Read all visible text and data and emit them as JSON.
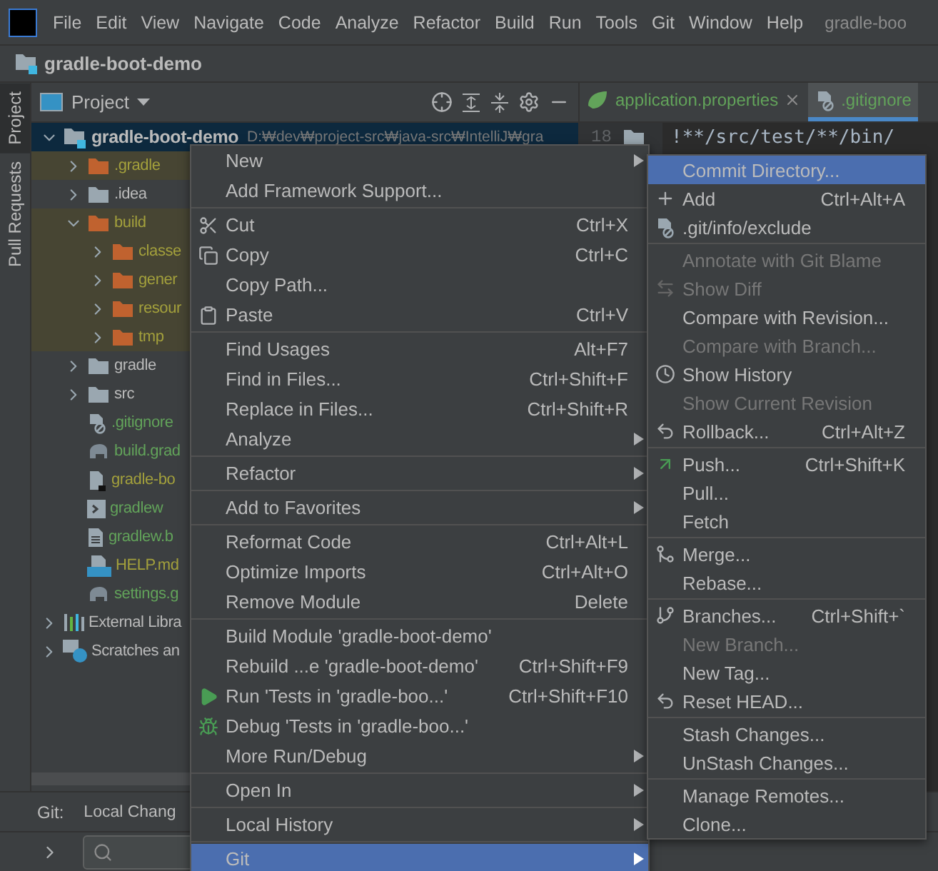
{
  "menu_bar": {
    "items": [
      "File",
      "Edit",
      "View",
      "Navigate",
      "Code",
      "Analyze",
      "Refactor",
      "Build",
      "Run",
      "Tools",
      "Git",
      "Window",
      "Help"
    ],
    "window_title": "gradle-boo"
  },
  "nav_bar": {
    "project": "gradle-boot-demo"
  },
  "side_tabs": [
    {
      "label": "Project",
      "selected": true
    },
    {
      "label": "Pull Requests",
      "selected": false
    }
  ],
  "project_panel": {
    "title": "Project",
    "tree": [
      {
        "label": "gradle-boot-demo",
        "path": "D:₩dev₩project-src₩java-src₩IntelliJ₩gra",
        "kind": "module",
        "color": "#bbbbbb",
        "expanded": true,
        "selected": true,
        "excluded": false,
        "children": [
          {
            "label": ".gradle",
            "kind": "folder",
            "color": "#a3a03c",
            "expanded": false,
            "selected": false,
            "excluded": true
          },
          {
            "label": ".idea",
            "kind": "folder-plain",
            "color": "#bbbbbb",
            "expanded": false,
            "selected": false,
            "excluded": false
          },
          {
            "label": "build",
            "kind": "folder",
            "color": "#a3a03c",
            "expanded": true,
            "selected": false,
            "excluded": true,
            "children": [
              {
                "label": "classe",
                "kind": "folder",
                "color": "#a3a03c",
                "expanded": false,
                "selected": false,
                "excluded": true
              },
              {
                "label": "gener",
                "kind": "folder",
                "color": "#a3a03c",
                "expanded": false,
                "selected": false,
                "excluded": true
              },
              {
                "label": "resour",
                "kind": "folder",
                "color": "#a3a03c",
                "expanded": false,
                "selected": false,
                "excluded": true
              },
              {
                "label": "tmp",
                "kind": "folder",
                "color": "#a3a03c",
                "expanded": false,
                "selected": false,
                "excluded": true
              }
            ]
          },
          {
            "label": "gradle",
            "kind": "folder-plain",
            "color": "#bbbbbb",
            "expanded": false,
            "selected": false,
            "excluded": false
          },
          {
            "label": "src",
            "kind": "folder-plain",
            "color": "#bbbbbb",
            "expanded": false,
            "selected": false,
            "excluded": false
          },
          {
            "label": ".gitignore",
            "kind": "ignore-file",
            "color": "#62a35a",
            "selected": false,
            "excluded": false
          },
          {
            "label": "build.grad",
            "kind": "gradle",
            "color": "#62a35a",
            "selected": false,
            "excluded": false
          },
          {
            "label": "gradle-bo",
            "kind": "file",
            "color": "#a3a03c",
            "selected": false,
            "excluded": false
          },
          {
            "label": "gradlew",
            "kind": "script",
            "color": "#62a35a",
            "selected": false,
            "excluded": false
          },
          {
            "label": "gradlew.b",
            "kind": "text",
            "color": "#62a35a",
            "selected": false,
            "excluded": false
          },
          {
            "label": "HELP.md",
            "kind": "markdown",
            "color": "#a3a03c",
            "selected": false,
            "excluded": false
          },
          {
            "label": "settings.g",
            "kind": "gradle",
            "color": "#62a35a",
            "selected": false,
            "excluded": false
          }
        ]
      },
      {
        "label": "External Libra",
        "kind": "libraries",
        "color": "#bbbbbb",
        "expanded": false,
        "selected": false,
        "excluded": false
      },
      {
        "label": "Scratches an",
        "kind": "scratches",
        "color": "#bbbbbb",
        "expanded": false,
        "selected": false,
        "excluded": false
      }
    ]
  },
  "editor": {
    "tabs": [
      {
        "label": "application.properties",
        "kind": "spring",
        "selected": false,
        "closable": true
      },
      {
        "label": ".gitignore",
        "kind": "ignore-file",
        "selected": true,
        "closable": false
      }
    ],
    "lines": [
      {
        "number": "18",
        "text": "!**/src/test/**/bin/"
      }
    ]
  },
  "bottom_panel": {
    "title": "Git:",
    "tab": "Local Chang"
  },
  "context_menu": [
    {
      "kind": "item",
      "label": "New",
      "submenu": true,
      "selected": false
    },
    {
      "kind": "item",
      "label": "Add Framework Support...",
      "selected": false
    },
    {
      "kind": "separator"
    },
    {
      "kind": "cut",
      "label": "Cut",
      "shortcut": "Ctrl+X",
      "selected": false
    },
    {
      "kind": "copy",
      "label": "Copy",
      "shortcut": "Ctrl+C",
      "selected": false
    },
    {
      "kind": "item",
      "label": "Copy Path...",
      "selected": false
    },
    {
      "kind": "paste",
      "label": "Paste",
      "shortcut": "Ctrl+V",
      "selected": false
    },
    {
      "kind": "separator"
    },
    {
      "kind": "item",
      "label": "Find Usages",
      "shortcut": "Alt+F7",
      "selected": false
    },
    {
      "kind": "item",
      "label": "Find in Files...",
      "shortcut": "Ctrl+Shift+F",
      "selected": false
    },
    {
      "kind": "item",
      "label": "Replace in Files...",
      "shortcut": "Ctrl+Shift+R",
      "selected": false
    },
    {
      "kind": "item",
      "label": "Analyze",
      "submenu": true,
      "selected": false
    },
    {
      "kind": "separator"
    },
    {
      "kind": "item",
      "label": "Refactor",
      "submenu": true,
      "selected": false
    },
    {
      "kind": "separator"
    },
    {
      "kind": "item",
      "label": "Add to Favorites",
      "submenu": true,
      "selected": false
    },
    {
      "kind": "separator"
    },
    {
      "kind": "item",
      "label": "Reformat Code",
      "shortcut": "Ctrl+Alt+L",
      "selected": false
    },
    {
      "kind": "item",
      "label": "Optimize Imports",
      "shortcut": "Ctrl+Alt+O",
      "selected": false
    },
    {
      "kind": "item",
      "label": "Remove Module",
      "shortcut": "Delete",
      "selected": false
    },
    {
      "kind": "separator"
    },
    {
      "kind": "item",
      "label": "Build Module 'gradle-boot-demo'",
      "selected": false
    },
    {
      "kind": "item",
      "label": "Rebuild ...e 'gradle-boot-demo'",
      "shortcut": "Ctrl+Shift+F9",
      "selected": false
    },
    {
      "kind": "run",
      "label": "Run 'Tests in 'gradle-boo...'",
      "shortcut": "Ctrl+Shift+F10",
      "selected": false
    },
    {
      "kind": "debug",
      "label": "Debug 'Tests in 'gradle-boo...'",
      "selected": false
    },
    {
      "kind": "item",
      "label": "More Run/Debug",
      "submenu": true,
      "selected": false
    },
    {
      "kind": "separator"
    },
    {
      "kind": "item",
      "label": "Open In",
      "submenu": true,
      "selected": false
    },
    {
      "kind": "separator"
    },
    {
      "kind": "item",
      "label": "Local History",
      "submenu": true,
      "selected": false
    },
    {
      "kind": "separator"
    },
    {
      "kind": "item",
      "label": "Git",
      "submenu": true,
      "selected": true
    }
  ],
  "git_submenu": [
    {
      "kind": "item",
      "label": "Commit Directory...",
      "selected": true,
      "disabled": false
    },
    {
      "kind": "add",
      "label": "Add",
      "shortcut": "Ctrl+Alt+A",
      "selected": false,
      "disabled": false
    },
    {
      "kind": "ignore-file",
      "label": ".git/info/exclude",
      "selected": false,
      "disabled": false
    },
    {
      "kind": "separator"
    },
    {
      "kind": "item",
      "label": "Annotate with Git Blame",
      "selected": false,
      "disabled": true
    },
    {
      "kind": "diff",
      "label": "Show Diff",
      "selected": false,
      "disabled": true
    },
    {
      "kind": "item",
      "label": "Compare with Revision...",
      "selected": false,
      "disabled": false
    },
    {
      "kind": "item",
      "label": "Compare with Branch...",
      "selected": false,
      "disabled": true
    },
    {
      "kind": "history",
      "label": "Show History",
      "selected": false,
      "disabled": false
    },
    {
      "kind": "item",
      "label": "Show Current Revision",
      "selected": false,
      "disabled": true
    },
    {
      "kind": "rollback",
      "label": "Rollback...",
      "shortcut": "Ctrl+Alt+Z",
      "selected": false,
      "disabled": false
    },
    {
      "kind": "separator"
    },
    {
      "kind": "push",
      "label": "Push...",
      "shortcut": "Ctrl+Shift+K",
      "selected": false,
      "disabled": false
    },
    {
      "kind": "item",
      "label": "Pull...",
      "selected": false,
      "disabled": false
    },
    {
      "kind": "item",
      "label": "Fetch",
      "selected": false,
      "disabled": false
    },
    {
      "kind": "separator"
    },
    {
      "kind": "merge",
      "label": "Merge...",
      "selected": false,
      "disabled": false
    },
    {
      "kind": "item",
      "label": "Rebase...",
      "selected": false,
      "disabled": false
    },
    {
      "kind": "separator"
    },
    {
      "kind": "branch",
      "label": "Branches...",
      "shortcut": "Ctrl+Shift+`",
      "selected": false,
      "disabled": false
    },
    {
      "kind": "item",
      "label": "New Branch...",
      "selected": false,
      "disabled": true
    },
    {
      "kind": "item",
      "label": "New Tag...",
      "selected": false,
      "disabled": false
    },
    {
      "kind": "rollback",
      "label": "Reset HEAD...",
      "selected": false,
      "disabled": false
    },
    {
      "kind": "separator"
    },
    {
      "kind": "item",
      "label": "Stash Changes...",
      "selected": false,
      "disabled": false
    },
    {
      "kind": "item",
      "label": "UnStash Changes...",
      "selected": false,
      "disabled": false
    },
    {
      "kind": "separator"
    },
    {
      "kind": "item",
      "label": "Manage Remotes...",
      "selected": false,
      "disabled": false
    },
    {
      "kind": "item",
      "label": "Clone...",
      "selected": false,
      "disabled": false
    }
  ]
}
